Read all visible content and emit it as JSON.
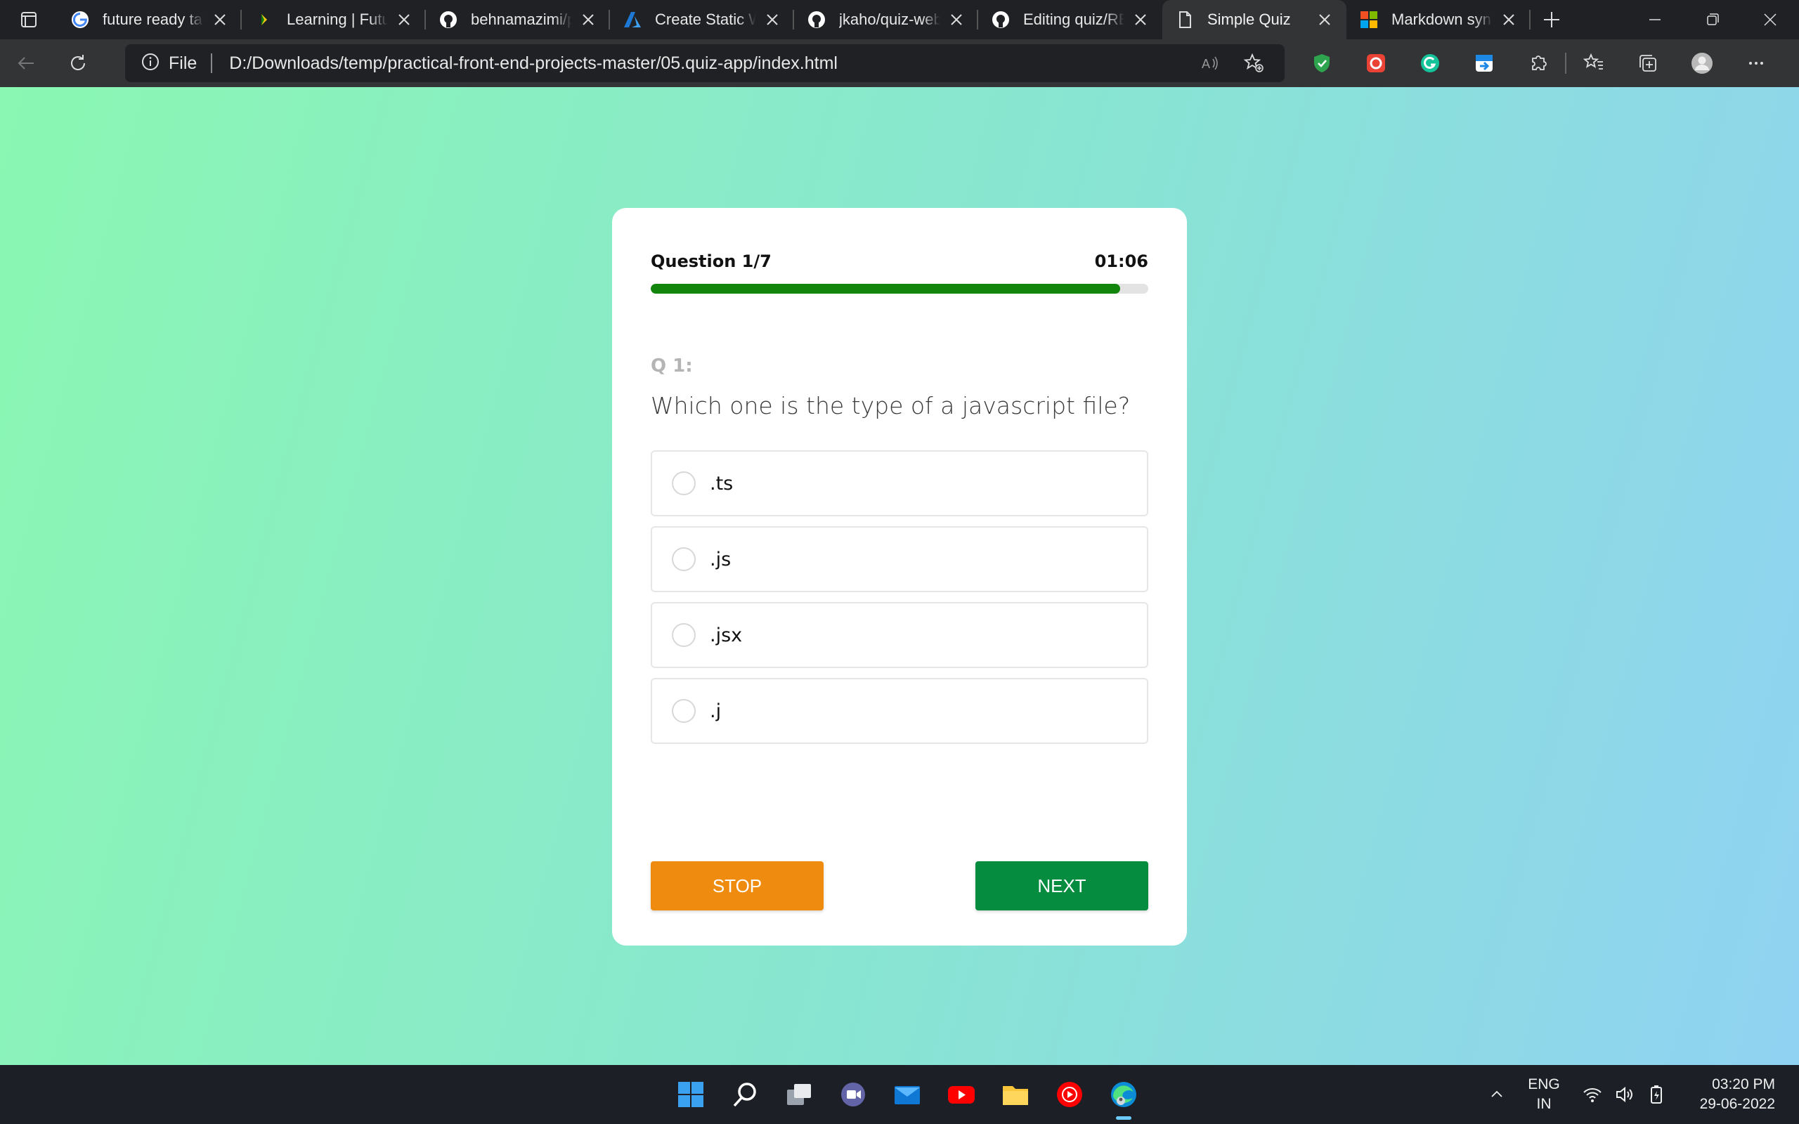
{
  "browser": {
    "tabs": [
      {
        "title": "future ready talent",
        "favicon": "google-icon"
      },
      {
        "title": "Learning | Future Ready Talent",
        "favicon": "learning-icon"
      },
      {
        "title": "behnamazimi/practical-front-end-projects",
        "favicon": "github-icon"
      },
      {
        "title": "Create Static Web Apps",
        "favicon": "azure-icon"
      },
      {
        "title": "jkaho/quiz-web-app",
        "favicon": "github-icon"
      },
      {
        "title": "Editing quiz/README.md",
        "favicon": "github-icon"
      },
      {
        "title": "Simple Quiz",
        "favicon": "page-icon",
        "active": true
      },
      {
        "title": "Markdown syntax",
        "favicon": "microsoft-icon"
      }
    ],
    "address": {
      "scheme_label": "File",
      "url": "D:/Downloads/temp/practical-front-end-projects-master/05.quiz-app/index.html"
    }
  },
  "quiz": {
    "progress_label": "Question 1/7",
    "timer": "01:06",
    "progress_fraction": 0.943,
    "question_number": "Q 1:",
    "question_text": "Which one is the type of a javascript file?",
    "options": [
      ".ts",
      ".js",
      ".jsx",
      ".j"
    ],
    "stop_label": "STOP",
    "next_label": "NEXT",
    "colors": {
      "stop": "#ef8b0e",
      "next": "#058c3f",
      "progress": "#12850c"
    }
  },
  "taskbar": {
    "language": "ENG",
    "region": "IN",
    "time": "03:20 PM",
    "date": "29-06-2022"
  }
}
